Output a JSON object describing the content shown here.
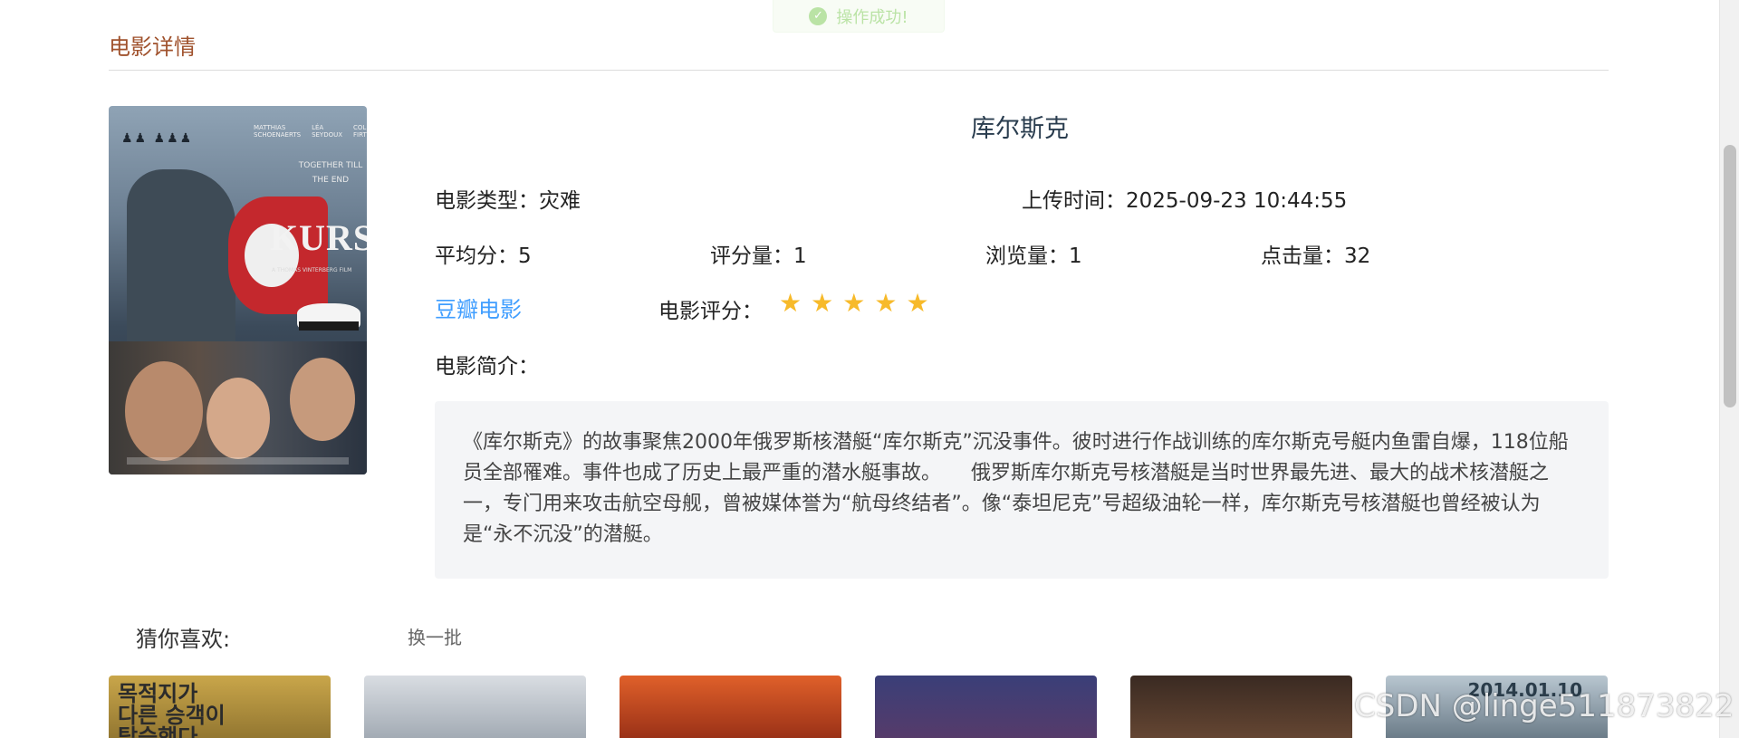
{
  "toast": {
    "message": "操作成功!"
  },
  "section": {
    "title": "电影详情"
  },
  "movie": {
    "name": "库尔斯克",
    "poster": {
      "title": "KURSK",
      "names": [
        "MATTHIAS SCHOENAERTS",
        "LÉA SEYDOUX",
        "COLIN FIRTH"
      ],
      "tagline": "TOGETHER TILL THE END",
      "sub": "A THOMAS VINTERBERG FILM"
    },
    "type_label": "电影类型：",
    "type_value": "灾难",
    "upload_label": "上传时间：",
    "upload_value": "2025-09-23 10:44:55",
    "avg_label": "平均分：",
    "avg_value": "5",
    "ratings_label": "评分量：",
    "ratings_value": "1",
    "views_label": "浏览量：",
    "views_value": "1",
    "clicks_label": "点击量：",
    "clicks_value": "32",
    "douban_link": "豆瓣电影",
    "rating_label": "电影评分：",
    "rating_stars": 5,
    "rating_max": 5,
    "intro_label": "电影简介：",
    "intro_text": "《库尔斯克》的故事聚焦2000年俄罗斯核潜艇“库尔斯克”沉没事件。彼时进行作战训练的库尔斯克号艇内鱼雷自爆，118位船员全部罹难。事件也成了历史上最严重的潜水艇事故。　　俄罗斯库尔斯克号核潜艇是当时世界最先进、最大的战术核潜艇之一，专门用来攻击航空母舰，曾被媒体誉为“航母终结者”。像“泰坦尼克”号超级油轮一样，库尔斯克号核潜艇也曾经被认为是“永不沉没”的潜艇。"
  },
  "recommend": {
    "title": "猜你喜欢:",
    "refresh": "换一批",
    "cards": [
      {
        "text": "목적지가\n다른 승객이\n탑승했다",
        "colors": [
          "#c9a64a",
          "#8a6f2d"
        ]
      },
      {
        "text": "",
        "colors": [
          "#d9dde2",
          "#9aa3ad"
        ]
      },
      {
        "text": "",
        "colors": [
          "#e0602a",
          "#8f2a14"
        ]
      },
      {
        "text": "",
        "colors": [
          "#3a3f78",
          "#5a3a68"
        ]
      },
      {
        "text": "",
        "colors": [
          "#3a2a22",
          "#6b4a35"
        ]
      },
      {
        "text": "",
        "date": "2014.01.10",
        "colors": [
          "#b8c6d0",
          "#5f707d"
        ]
      }
    ]
  },
  "watermark": "CSDN @linge511873822"
}
